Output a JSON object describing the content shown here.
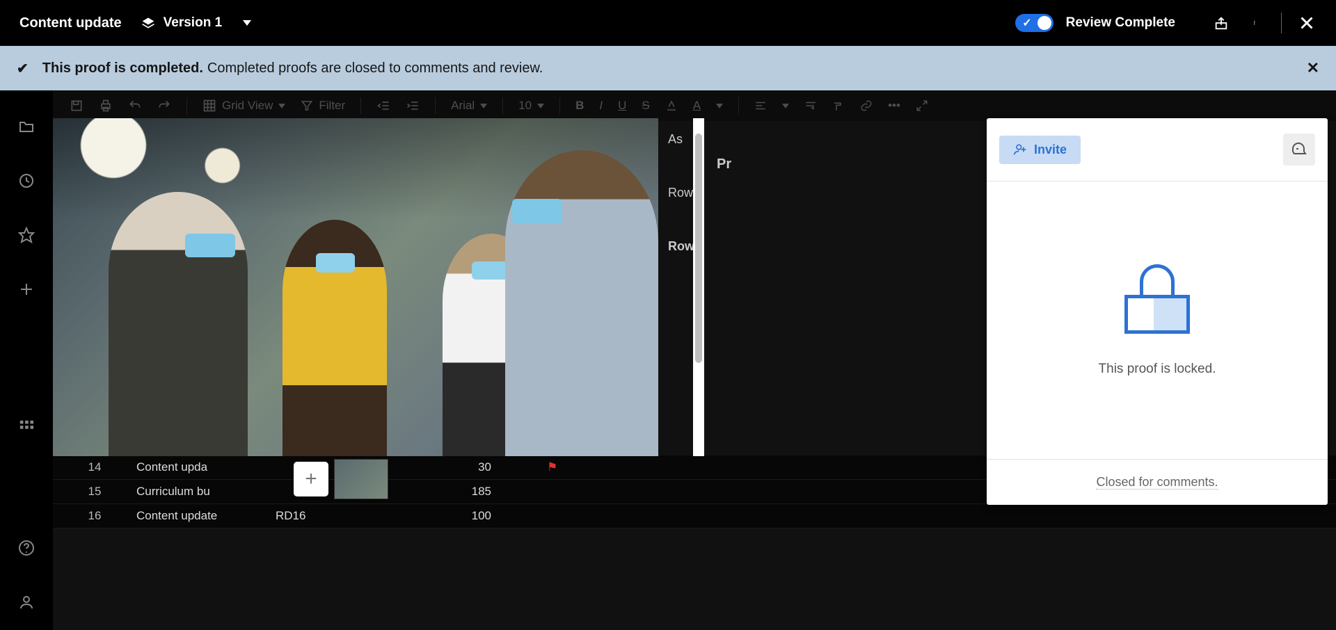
{
  "header": {
    "title": "Content update",
    "version_label": "Version 1",
    "review_label": "Review Complete"
  },
  "banner": {
    "bold": "This proof is completed.",
    "rest": "Completed proofs are closed to comments and review."
  },
  "bg_toolbar": {
    "view_label": "Grid View",
    "filter_label": "Filter",
    "font_label": "Arial",
    "font_size": "10"
  },
  "bg_columns": {
    "col_a": "As",
    "col_b": "Pr",
    "row_label_1": "Row",
    "row_label_2": "Row"
  },
  "bg_rows": [
    {
      "num": "14",
      "c1": "Content upda",
      "c2": "",
      "c3": "30",
      "flag": true
    },
    {
      "num": "15",
      "c1": "Curriculum bu",
      "c2": "",
      "c3": "185",
      "flag": false
    },
    {
      "num": "16",
      "c1": "Content update",
      "c2": "RD16",
      "c3": "100",
      "flag": false
    }
  ],
  "side_panel": {
    "invite_label": "Invite",
    "locked_text": "This proof is locked.",
    "footer_text": "Closed for comments."
  },
  "thumb": {
    "plus": "+"
  }
}
